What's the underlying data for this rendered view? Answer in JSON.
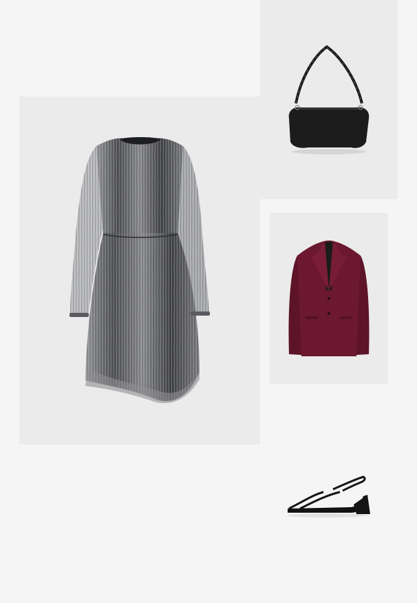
{
  "outfit": {
    "items": [
      {
        "id": "dress",
        "icon": "metallic-long-sleeve-dress",
        "color": "#5f6062"
      },
      {
        "id": "bag",
        "icon": "black-shoulder-bag",
        "color": "#1c1c1c"
      },
      {
        "id": "blazer",
        "icon": "burgundy-blazer",
        "color": "#6b1830"
      },
      {
        "id": "sandal",
        "icon": "black-strappy-heeled-sandal",
        "color": "#151515"
      }
    ]
  }
}
